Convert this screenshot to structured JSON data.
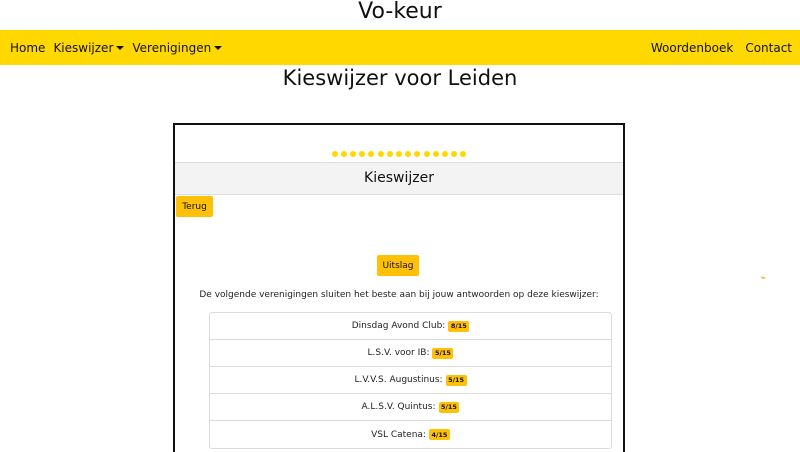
{
  "brand": "Vo-keur",
  "nav": {
    "left": [
      {
        "label": "Home"
      },
      {
        "label": "Kieswijzer"
      },
      {
        "label": "Verenigingen"
      }
    ],
    "right": [
      {
        "label": "Woordenboek"
      },
      {
        "label": "Contact"
      }
    ]
  },
  "page_title": "Kieswijzer voor Leiden",
  "card": {
    "progress": {
      "total": 15,
      "color": "#ffd800"
    },
    "header": "Kieswijzer",
    "back_label": "Terug",
    "result_label": "Uitslag",
    "intro": "De volgende verenigingen sluiten het beste aan bij jouw antwoorden op deze kieswijzer:",
    "results": [
      {
        "name": "Dinsdag Avond Club:",
        "score": "8/15"
      },
      {
        "name": "L.S.V. voor IB:",
        "score": "5/15"
      },
      {
        "name": "L.V.V.S. Augustinus:",
        "score": "5/15"
      },
      {
        "name": "A.L.S.V. Quintus:",
        "score": "5/15"
      },
      {
        "name": "VSL Catena:",
        "score": "4/15"
      }
    ]
  },
  "colors": {
    "navbar": "#ffd800",
    "button": "#ffc107"
  },
  "side_widget_icon": "beer-mug-icon"
}
